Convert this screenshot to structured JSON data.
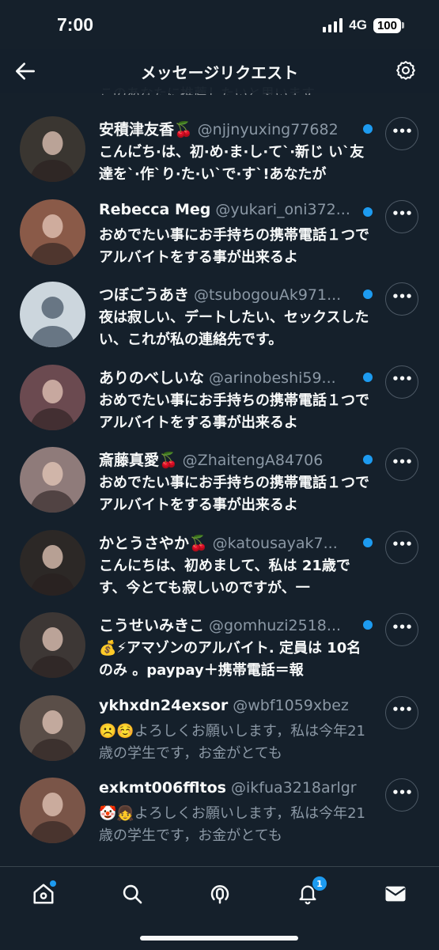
{
  "status_bar": {
    "time": "7:00",
    "network": "4G",
    "battery": "100"
  },
  "header": {
    "title": "メッセージリクエスト"
  },
  "partial_preview": "このあなたに推薦したいと思います。",
  "rows": [
    {
      "name": "安積津友香🍒",
      "handle": "@njjnyuxing77682",
      "preview": "こんに゙ち·は、初·め·ま·し·て`·新じ い`友達を`·作`り·た·い`で·す`!あなたが",
      "unread": true,
      "avatar_bg": "#3a3631"
    },
    {
      "name": "Rebecca Meg",
      "handle": "@yukari_oni372...",
      "preview": "おめでたい事にお手持ちの携帯電話１つでアルバイトをする事が出来るよ",
      "unread": true,
      "avatar_bg": "#8a5a48"
    },
    {
      "name": "つぼごうあき",
      "handle": "@tsubogouAk971...",
      "preview": "夜は寂しい、デートしたい、セックスしたい、これが私の連絡先です。",
      "unread": true,
      "avatar_bg": "#ccd6dd"
    },
    {
      "name": "ありのべしいな",
      "handle": "@arinobeshi59...",
      "preview": "おめでたい事にお手持ちの携帯電話１つでアルバイトをする事が出来るよ",
      "unread": true,
      "avatar_bg": "#6b4a50"
    },
    {
      "name": "斎藤真愛🍒",
      "handle": "@ZhaitengA84706",
      "preview": "おめでたい事にお手持ちの携帯電話１つでアルバイトをする事が出来るよ",
      "unread": true,
      "avatar_bg": "#8f7b7a"
    },
    {
      "name": "かとうさやか🍒",
      "handle": "@katousayak7...",
      "preview": "こんにちは、初めまして、私は 21歳です、今とても寂しいのですが、一",
      "unread": true,
      "avatar_bg": "#2c2826"
    },
    {
      "name": "こうせいみきこ",
      "handle": "@gomhuzi2518...",
      "preview": "💰⚡アマゾンのアルバイト. 定員は 10名のみ 。paypay＋携帯電話＝報",
      "unread": true,
      "avatar_bg": "#3d3735"
    },
    {
      "name": "ykhxdn24exsor",
      "handle": "@wbf1059xbez",
      "preview": "☹️☺️よろしくお願いします，私は今年21歳の学生です，お金がとても",
      "unread": false,
      "avatar_bg": "#5a4e48"
    },
    {
      "name": "exkmt006ffltos",
      "handle": "@ikfua3218arlgr",
      "preview": "🤡👧よろしくお願いします，私は今年21歳の学生です，お金がとても",
      "unread": false,
      "avatar_bg": "#7a5548"
    }
  ],
  "nav": {
    "notifications_badge": "1"
  },
  "colors": {
    "background": "#15202b",
    "accent": "#1d9bf0",
    "secondary_text": "#8b98a5"
  }
}
